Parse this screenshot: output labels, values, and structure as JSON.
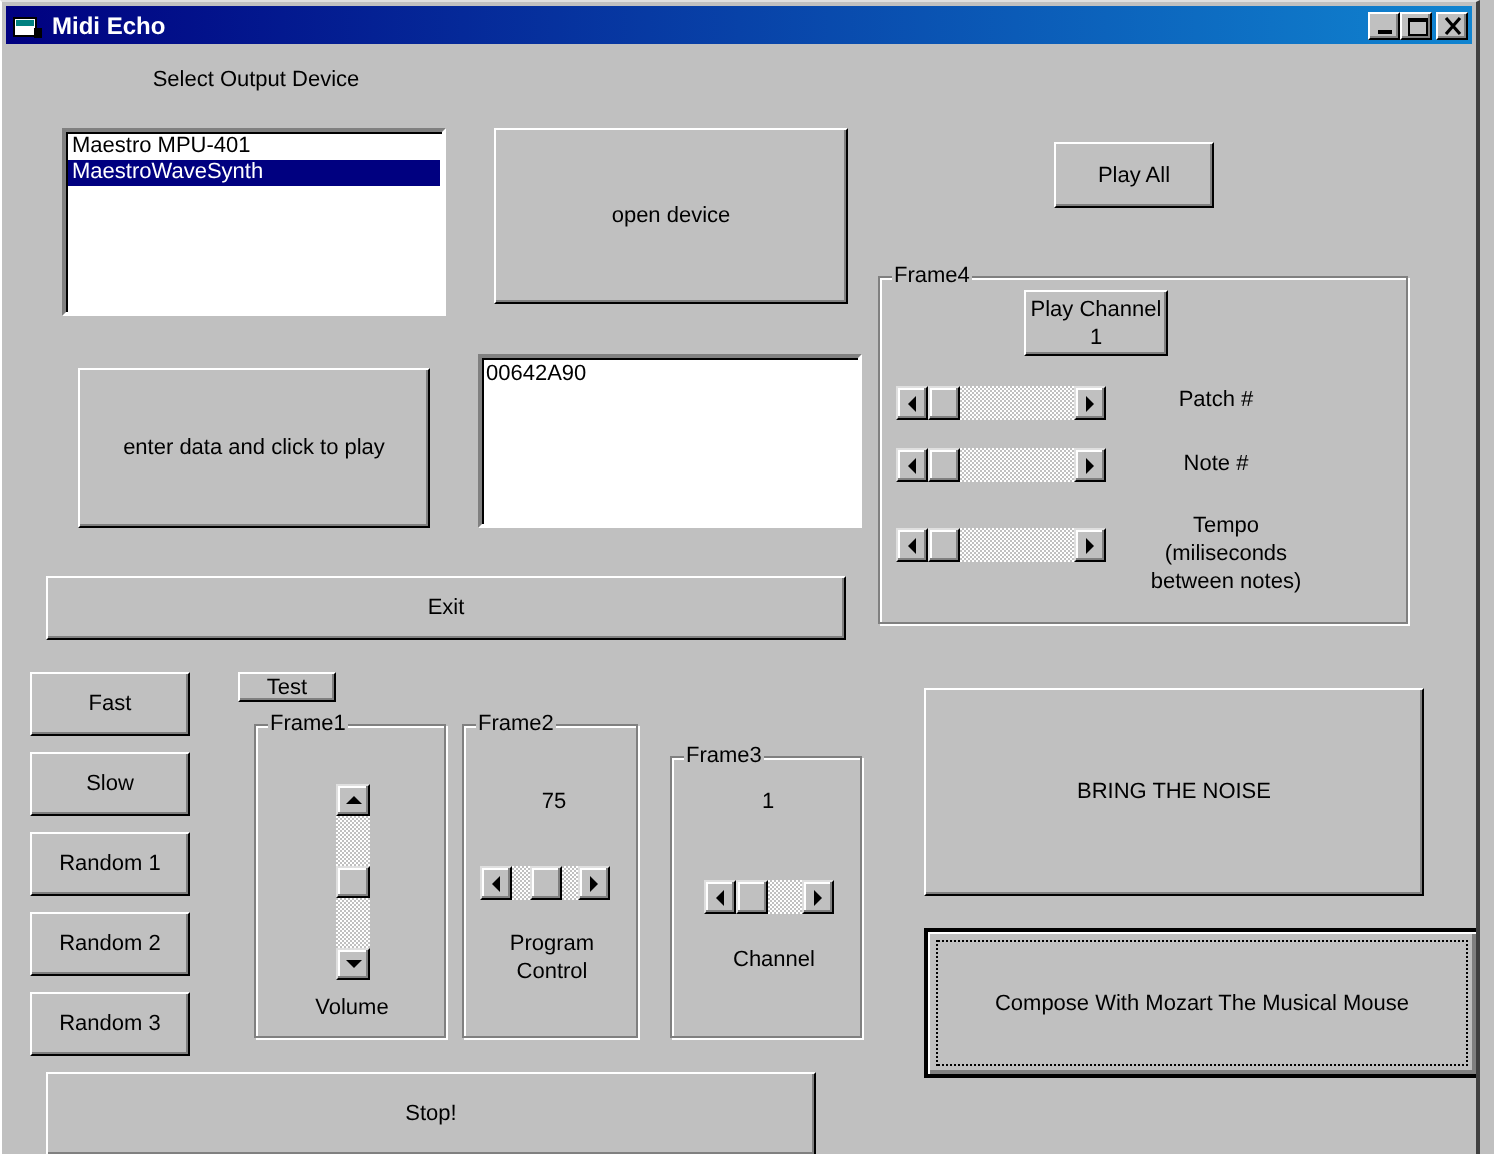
{
  "window": {
    "title": "Midi Echo"
  },
  "controls": [
    {
      "kind": "label",
      "text": "Select Output Device"
    },
    {
      "kind": "listbox",
      "items": [
        {
          "text": "Maestro MPU-401",
          "selected": false
        },
        {
          "text": "MaestroWaveSynth",
          "selected": true
        }
      ]
    },
    {
      "kind": "button",
      "text": "open device",
      "focused": false
    },
    {
      "kind": "button",
      "text": "Play All",
      "focused": false
    },
    {
      "kind": "frame",
      "title": "Frame4",
      "children": [
        {
          "kind": "button",
          "text": "Play Channel 1",
          "focused": false
        },
        {
          "kind": "hscroll",
          "level": 0
        },
        {
          "kind": "label",
          "text": "Patch #"
        },
        {
          "kind": "hscroll",
          "level": 0
        },
        {
          "kind": "label",
          "text": "Note #"
        },
        {
          "kind": "hscroll",
          "level": 0
        },
        {
          "kind": "label",
          "text": "Tempo (miliseconds between notes)"
        }
      ]
    },
    {
      "kind": "button",
      "text": "enter data and click to play",
      "focused": false
    },
    {
      "kind": "textbox",
      "value": "00642A90"
    },
    {
      "kind": "button",
      "text": "Exit",
      "focused": false
    },
    {
      "kind": "button",
      "text": "Fast",
      "focused": false
    },
    {
      "kind": "button",
      "text": "Slow",
      "focused": false
    },
    {
      "kind": "button",
      "text": "Random 1",
      "focused": false
    },
    {
      "kind": "button",
      "text": "Random 2",
      "focused": false
    },
    {
      "kind": "button",
      "text": "Random 3",
      "focused": false
    },
    {
      "kind": "button",
      "text": "Test",
      "focused": false
    },
    {
      "kind": "frame",
      "title": "Frame1",
      "children": [
        {
          "kind": "vscroll",
          "level": 0.5
        },
        {
          "kind": "label",
          "text": "Volume"
        }
      ]
    },
    {
      "kind": "frame",
      "title": "Frame2",
      "children": [
        {
          "kind": "label",
          "text": "75"
        },
        {
          "kind": "hscroll",
          "level": 0.55
        },
        {
          "kind": "label",
          "text": "Program Control"
        }
      ]
    },
    {
      "kind": "frame",
      "title": "Frame3",
      "children": [
        {
          "kind": "label",
          "text": "1"
        },
        {
          "kind": "hscroll",
          "level": 0
        },
        {
          "kind": "label",
          "text": "Channel"
        }
      ]
    },
    {
      "kind": "button",
      "text": "BRING THE NOISE",
      "focused": false
    },
    {
      "kind": "button",
      "text": "Compose With Mozart The Musical Mouse",
      "focused": true
    },
    {
      "kind": "button",
      "text": "Stop!",
      "focused": false
    }
  ]
}
